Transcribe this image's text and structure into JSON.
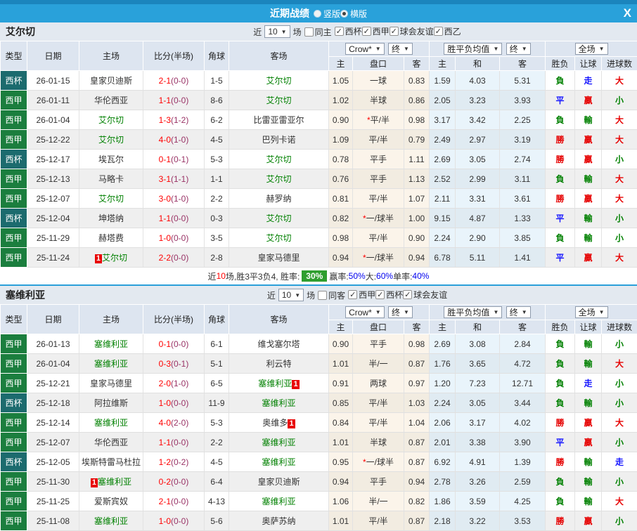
{
  "titlebar": {
    "title": "近期战绩",
    "layout_options": [
      {
        "label": "竖版",
        "selected": false
      },
      {
        "label": "横版",
        "selected": true
      }
    ],
    "close": "X"
  },
  "columns": {
    "main": [
      "类型",
      "日期",
      "主场",
      "比分(半场)",
      "角球",
      "客场"
    ],
    "sub": [
      "主",
      "盘口",
      "客",
      "主",
      "和",
      "客",
      "胜负",
      "让球",
      "进球数"
    ]
  },
  "dropdowns": {
    "company": "Crow*",
    "company_state": "终",
    "avg": "胜平负均值",
    "avg_state": "终",
    "scope": "全场"
  },
  "filter_labels": {
    "prefix": "近",
    "suffix": "场"
  },
  "sections": [
    {
      "team": "艾尔切",
      "filter": {
        "count": "10",
        "same_label": "同主",
        "same_checked": false,
        "leagues": [
          {
            "label": "西杯",
            "checked": true
          },
          {
            "label": "西甲",
            "checked": true
          },
          {
            "label": "球会友谊",
            "checked": true
          },
          {
            "label": "西乙",
            "checked": true
          }
        ]
      },
      "rows": [
        {
          "type": "西杯",
          "date": "26-01-15",
          "home": "皇家贝迪斯",
          "home_focus": false,
          "home_card": "",
          "score": "2-1",
          "half": "(0-0)",
          "corner": "1-5",
          "away": "艾尔切",
          "away_focus": true,
          "away_card": "",
          "odds": [
            "1.05",
            "一球",
            "0.83"
          ],
          "star": false,
          "avg": [
            "1.59",
            "4.03",
            "5.31"
          ],
          "result": [
            "負",
            "g"
          ],
          "let": [
            "走",
            "b"
          ],
          "goals": [
            "大",
            "r"
          ]
        },
        {
          "type": "西甲",
          "date": "26-01-11",
          "home": "华伦西亚",
          "home_focus": false,
          "home_card": "",
          "score": "1-1",
          "half": "(0-0)",
          "corner": "8-6",
          "away": "艾尔切",
          "away_focus": true,
          "away_card": "",
          "odds": [
            "1.02",
            "半球",
            "0.86"
          ],
          "star": false,
          "avg": [
            "2.05",
            "3.23",
            "3.93"
          ],
          "result": [
            "平",
            "b"
          ],
          "let": [
            "贏",
            "r"
          ],
          "goals": [
            "小",
            "g"
          ]
        },
        {
          "type": "西甲",
          "date": "26-01-04",
          "home": "艾尔切",
          "home_focus": true,
          "home_card": "",
          "score": "1-3",
          "half": "(1-2)",
          "corner": "6-2",
          "away": "比雷亚雷亚尔",
          "away_focus": false,
          "away_card": "",
          "odds": [
            "0.90",
            "平/半",
            "0.98"
          ],
          "star": true,
          "avg": [
            "3.17",
            "3.42",
            "2.25"
          ],
          "result": [
            "負",
            "g"
          ],
          "let": [
            "輸",
            "g"
          ],
          "goals": [
            "大",
            "r"
          ]
        },
        {
          "type": "西甲",
          "date": "25-12-22",
          "home": "艾尔切",
          "home_focus": true,
          "home_card": "",
          "score": "4-0",
          "half": "(1-0)",
          "corner": "4-5",
          "away": "巴列卡诺",
          "away_focus": false,
          "away_card": "",
          "odds": [
            "1.09",
            "平/半",
            "0.79"
          ],
          "star": false,
          "avg": [
            "2.49",
            "2.97",
            "3.19"
          ],
          "result": [
            "勝",
            "r"
          ],
          "let": [
            "贏",
            "r"
          ],
          "goals": [
            "大",
            "r"
          ]
        },
        {
          "type": "西杯",
          "date": "25-12-17",
          "home": "埃瓦尔",
          "home_focus": false,
          "home_card": "",
          "score": "0-1",
          "half": "(0-1)",
          "corner": "5-3",
          "away": "艾尔切",
          "away_focus": true,
          "away_card": "",
          "odds": [
            "0.78",
            "平手",
            "1.11"
          ],
          "star": false,
          "avg": [
            "2.69",
            "3.05",
            "2.74"
          ],
          "result": [
            "勝",
            "r"
          ],
          "let": [
            "贏",
            "r"
          ],
          "goals": [
            "小",
            "g"
          ]
        },
        {
          "type": "西甲",
          "date": "25-12-13",
          "home": "马略卡",
          "home_focus": false,
          "home_card": "",
          "score": "3-1",
          "half": "(1-1)",
          "corner": "1-1",
          "away": "艾尔切",
          "away_focus": true,
          "away_card": "",
          "odds": [
            "0.76",
            "平手",
            "1.13"
          ],
          "star": false,
          "avg": [
            "2.52",
            "2.99",
            "3.11"
          ],
          "result": [
            "負",
            "g"
          ],
          "let": [
            "輸",
            "g"
          ],
          "goals": [
            "大",
            "r"
          ]
        },
        {
          "type": "西甲",
          "date": "25-12-07",
          "home": "艾尔切",
          "home_focus": true,
          "home_card": "",
          "score": "3-0",
          "half": "(1-0)",
          "corner": "2-2",
          "away": "赫罗纳",
          "away_focus": false,
          "away_card": "",
          "odds": [
            "0.81",
            "平/半",
            "1.07"
          ],
          "star": false,
          "avg": [
            "2.11",
            "3.31",
            "3.61"
          ],
          "result": [
            "勝",
            "r"
          ],
          "let": [
            "贏",
            "r"
          ],
          "goals": [
            "大",
            "r"
          ]
        },
        {
          "type": "西杯",
          "date": "25-12-04",
          "home": "坤塔纳",
          "home_focus": false,
          "home_card": "",
          "score": "1-1",
          "half": "(0-0)",
          "corner": "0-3",
          "away": "艾尔切",
          "away_focus": true,
          "away_card": "",
          "odds": [
            "0.82",
            "一/球半",
            "1.00"
          ],
          "star": true,
          "avg": [
            "9.15",
            "4.87",
            "1.33"
          ],
          "result": [
            "平",
            "b"
          ],
          "let": [
            "輸",
            "g"
          ],
          "goals": [
            "小",
            "g"
          ]
        },
        {
          "type": "西甲",
          "date": "25-11-29",
          "home": "赫塔费",
          "home_focus": false,
          "home_card": "",
          "score": "1-0",
          "half": "(0-0)",
          "corner": "3-5",
          "away": "艾尔切",
          "away_focus": true,
          "away_card": "",
          "odds": [
            "0.98",
            "平/半",
            "0.90"
          ],
          "star": false,
          "avg": [
            "2.24",
            "2.90",
            "3.85"
          ],
          "result": [
            "負",
            "g"
          ],
          "let": [
            "輸",
            "g"
          ],
          "goals": [
            "小",
            "g"
          ]
        },
        {
          "type": "西甲",
          "date": "25-11-24",
          "home": "艾尔切",
          "home_focus": true,
          "home_card": "1",
          "score": "2-2",
          "half": "(0-0)",
          "corner": "2-8",
          "away": "皇家马德里",
          "away_focus": false,
          "away_card": "",
          "odds": [
            "0.94",
            "一/球半",
            "0.94"
          ],
          "star": true,
          "avg": [
            "6.78",
            "5.11",
            "1.41"
          ],
          "result": [
            "平",
            "b"
          ],
          "let": [
            "贏",
            "r"
          ],
          "goals": [
            "大",
            "r"
          ]
        }
      ],
      "summary": [
        {
          "text": "近",
          "style": "p"
        },
        {
          "text": "10",
          "style": "r"
        },
        {
          "text": "场,胜3平3负4, 胜率:",
          "style": "p"
        },
        {
          "text": "30%",
          "style": "badge"
        },
        {
          "text": " 赢率:",
          "style": "p"
        },
        {
          "text": "50%",
          "style": "b"
        },
        {
          "text": " 大:",
          "style": "p"
        },
        {
          "text": "60%",
          "style": "b"
        },
        {
          "text": " 单率:",
          "style": "p"
        },
        {
          "text": "40%",
          "style": "b"
        }
      ]
    },
    {
      "team": "塞维利亚",
      "filter": {
        "count": "10",
        "same_label": "同客",
        "same_checked": false,
        "leagues": [
          {
            "label": "西甲",
            "checked": true
          },
          {
            "label": "西杯",
            "checked": true
          },
          {
            "label": "球会友谊",
            "checked": true
          }
        ]
      },
      "rows": [
        {
          "type": "西甲",
          "date": "26-01-13",
          "home": "塞维利亚",
          "home_focus": true,
          "home_card": "",
          "score": "0-1",
          "half": "(0-0)",
          "corner": "6-1",
          "away": "维戈塞尔塔",
          "away_focus": false,
          "away_card": "",
          "odds": [
            "0.90",
            "平手",
            "0.98"
          ],
          "star": false,
          "avg": [
            "2.69",
            "3.08",
            "2.84"
          ],
          "result": [
            "負",
            "g"
          ],
          "let": [
            "輸",
            "g"
          ],
          "goals": [
            "小",
            "g"
          ]
        },
        {
          "type": "西甲",
          "date": "26-01-04",
          "home": "塞维利亚",
          "home_focus": true,
          "home_card": "",
          "score": "0-3",
          "half": "(0-1)",
          "corner": "5-1",
          "away": "利云特",
          "away_focus": false,
          "away_card": "",
          "odds": [
            "1.01",
            "半/一",
            "0.87"
          ],
          "star": false,
          "avg": [
            "1.76",
            "3.65",
            "4.72"
          ],
          "result": [
            "負",
            "g"
          ],
          "let": [
            "輸",
            "g"
          ],
          "goals": [
            "大",
            "r"
          ]
        },
        {
          "type": "西甲",
          "date": "25-12-21",
          "home": "皇家马德里",
          "home_focus": false,
          "home_card": "",
          "score": "2-0",
          "half": "(1-0)",
          "corner": "6-5",
          "away": "塞维利亚",
          "away_focus": true,
          "away_card": "1",
          "odds": [
            "0.91",
            "两球",
            "0.97"
          ],
          "star": false,
          "avg": [
            "1.20",
            "7.23",
            "12.71"
          ],
          "result": [
            "負",
            "g"
          ],
          "let": [
            "走",
            "b"
          ],
          "goals": [
            "小",
            "g"
          ]
        },
        {
          "type": "西杯",
          "date": "25-12-18",
          "home": "阿拉维斯",
          "home_focus": false,
          "home_card": "",
          "score": "1-0",
          "half": "(0-0)",
          "corner": "11-9",
          "away": "塞维利亚",
          "away_focus": true,
          "away_card": "",
          "odds": [
            "0.85",
            "平/半",
            "1.03"
          ],
          "star": false,
          "avg": [
            "2.24",
            "3.05",
            "3.44"
          ],
          "result": [
            "負",
            "g"
          ],
          "let": [
            "輸",
            "g"
          ],
          "goals": [
            "小",
            "g"
          ]
        },
        {
          "type": "西甲",
          "date": "25-12-14",
          "home": "塞维利亚",
          "home_focus": true,
          "home_card": "",
          "score": "4-0",
          "half": "(2-0)",
          "corner": "5-3",
          "away": "奥维多",
          "away_focus": false,
          "away_card": "1",
          "odds": [
            "0.84",
            "平/半",
            "1.04"
          ],
          "star": false,
          "avg": [
            "2.06",
            "3.17",
            "4.02"
          ],
          "result": [
            "勝",
            "r"
          ],
          "let": [
            "贏",
            "r"
          ],
          "goals": [
            "大",
            "r"
          ]
        },
        {
          "type": "西甲",
          "date": "25-12-07",
          "home": "华伦西亚",
          "home_focus": false,
          "home_card": "",
          "score": "1-1",
          "half": "(0-0)",
          "corner": "2-2",
          "away": "塞维利亚",
          "away_focus": true,
          "away_card": "",
          "odds": [
            "1.01",
            "半球",
            "0.87"
          ],
          "star": false,
          "avg": [
            "2.01",
            "3.38",
            "3.90"
          ],
          "result": [
            "平",
            "b"
          ],
          "let": [
            "贏",
            "r"
          ],
          "goals": [
            "小",
            "g"
          ]
        },
        {
          "type": "西杯",
          "date": "25-12-05",
          "home": "埃斯特雷马杜拉",
          "home_focus": false,
          "home_card": "",
          "score": "1-2",
          "half": "(0-2)",
          "corner": "4-5",
          "away": "塞维利亚",
          "away_focus": true,
          "away_card": "",
          "odds": [
            "0.95",
            "一/球半",
            "0.87"
          ],
          "star": true,
          "avg": [
            "6.92",
            "4.91",
            "1.39"
          ],
          "result": [
            "勝",
            "r"
          ],
          "let": [
            "輸",
            "g"
          ],
          "goals": [
            "走",
            "b"
          ]
        },
        {
          "type": "西甲",
          "date": "25-11-30",
          "home": "塞维利亚",
          "home_focus": true,
          "home_card": "1",
          "score": "0-2",
          "half": "(0-0)",
          "corner": "6-4",
          "away": "皇家贝迪斯",
          "away_focus": false,
          "away_card": "",
          "odds": [
            "0.94",
            "平手",
            "0.94"
          ],
          "star": false,
          "avg": [
            "2.78",
            "3.26",
            "2.59"
          ],
          "result": [
            "負",
            "g"
          ],
          "let": [
            "輸",
            "g"
          ],
          "goals": [
            "小",
            "g"
          ]
        },
        {
          "type": "西甲",
          "date": "25-11-25",
          "home": "爱斯宾奴",
          "home_focus": false,
          "home_card": "",
          "score": "2-1",
          "half": "(0-0)",
          "corner": "4-13",
          "away": "塞维利亚",
          "away_focus": true,
          "away_card": "",
          "odds": [
            "1.06",
            "半/一",
            "0.82"
          ],
          "star": false,
          "avg": [
            "1.86",
            "3.59",
            "4.25"
          ],
          "result": [
            "負",
            "g"
          ],
          "let": [
            "輸",
            "g"
          ],
          "goals": [
            "大",
            "r"
          ]
        },
        {
          "type": "西甲",
          "date": "25-11-08",
          "home": "塞维利亚",
          "home_focus": true,
          "home_card": "",
          "score": "1-0",
          "half": "(0-0)",
          "corner": "5-6",
          "away": "奥萨苏纳",
          "away_focus": false,
          "away_card": "",
          "odds": [
            "1.01",
            "平/半",
            "0.87"
          ],
          "star": false,
          "avg": [
            "2.18",
            "3.22",
            "3.53"
          ],
          "result": [
            "勝",
            "r"
          ],
          "let": [
            "贏",
            "r"
          ],
          "goals": [
            "小",
            "g"
          ]
        }
      ],
      "summary": null
    }
  ]
}
